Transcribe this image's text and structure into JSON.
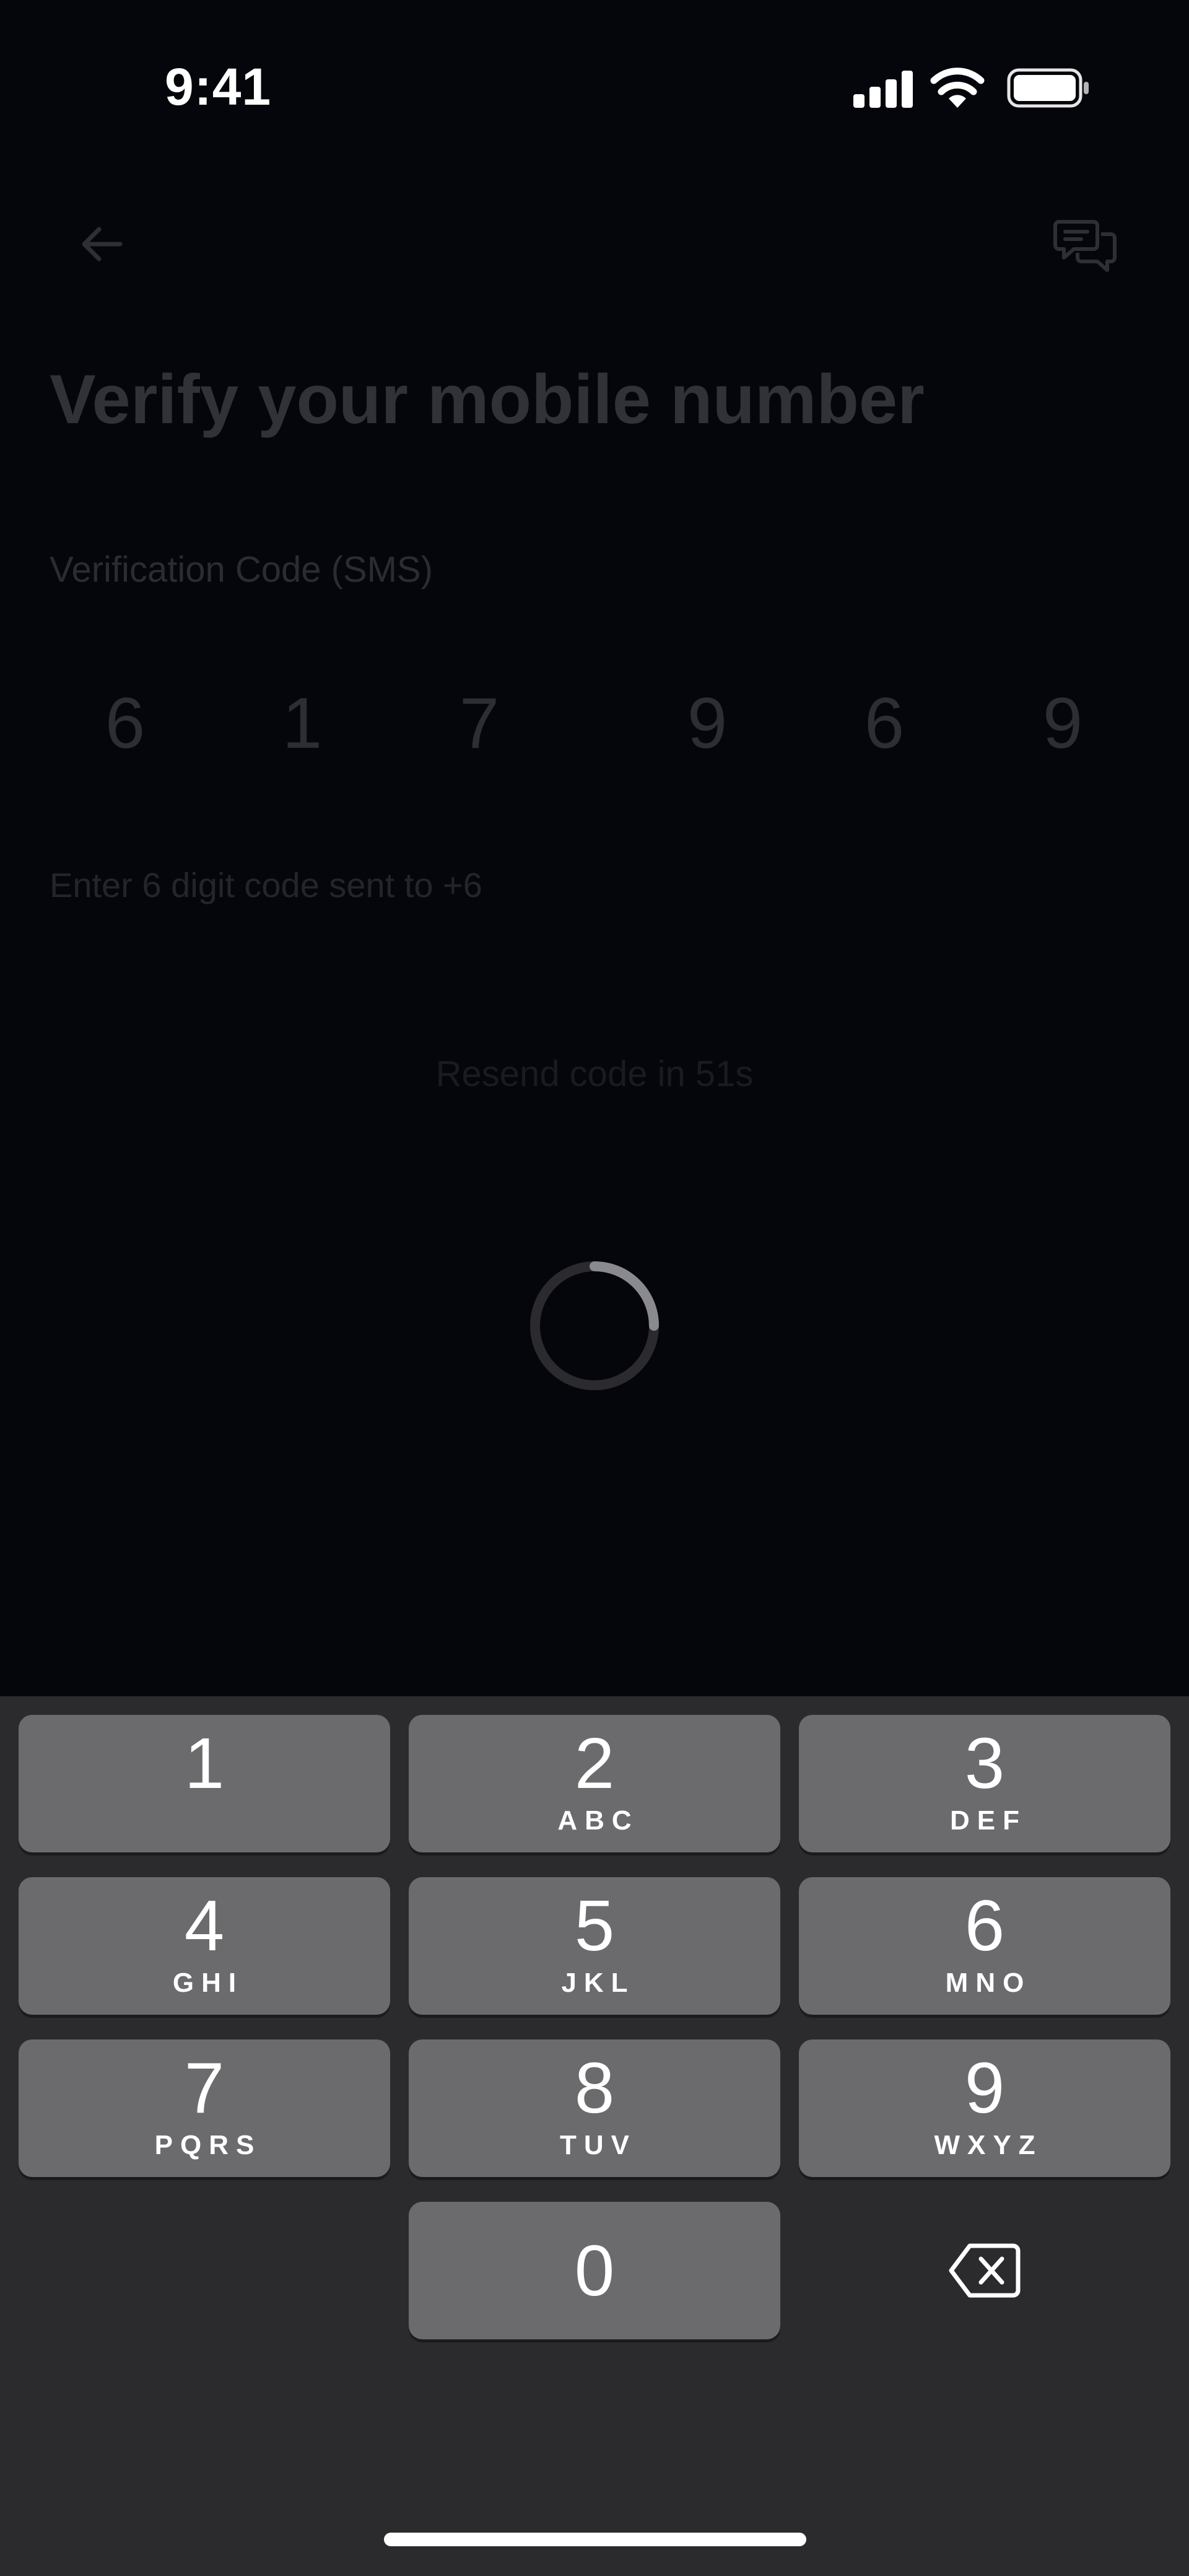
{
  "status_bar": {
    "time": "9:41"
  },
  "header": {
    "back_icon": "arrow-left-icon",
    "support_icon": "chat-bubbles-icon"
  },
  "title": "Verify your mobile number",
  "verification": {
    "label": "Verification Code (SMS)",
    "digits": [
      "6",
      "1",
      "7",
      "9",
      "6",
      "9"
    ],
    "helper": "Enter 6 digit code sent to +6",
    "resend": "Resend code in 51s"
  },
  "keypad": {
    "keys": [
      {
        "num": "1",
        "letters": ""
      },
      {
        "num": "2",
        "letters": "ABC"
      },
      {
        "num": "3",
        "letters": "DEF"
      },
      {
        "num": "4",
        "letters": "GHI"
      },
      {
        "num": "5",
        "letters": "JKL"
      },
      {
        "num": "6",
        "letters": "MNO"
      },
      {
        "num": "7",
        "letters": "PQRS"
      },
      {
        "num": "8",
        "letters": "TUV"
      },
      {
        "num": "9",
        "letters": "WXYZ"
      },
      {
        "num": "0",
        "letters": ""
      }
    ],
    "delete_icon": "backspace-icon"
  },
  "colors": {
    "background": "#05060b",
    "keyboard": "#2b2b2d",
    "key": "#6b6b6d"
  }
}
